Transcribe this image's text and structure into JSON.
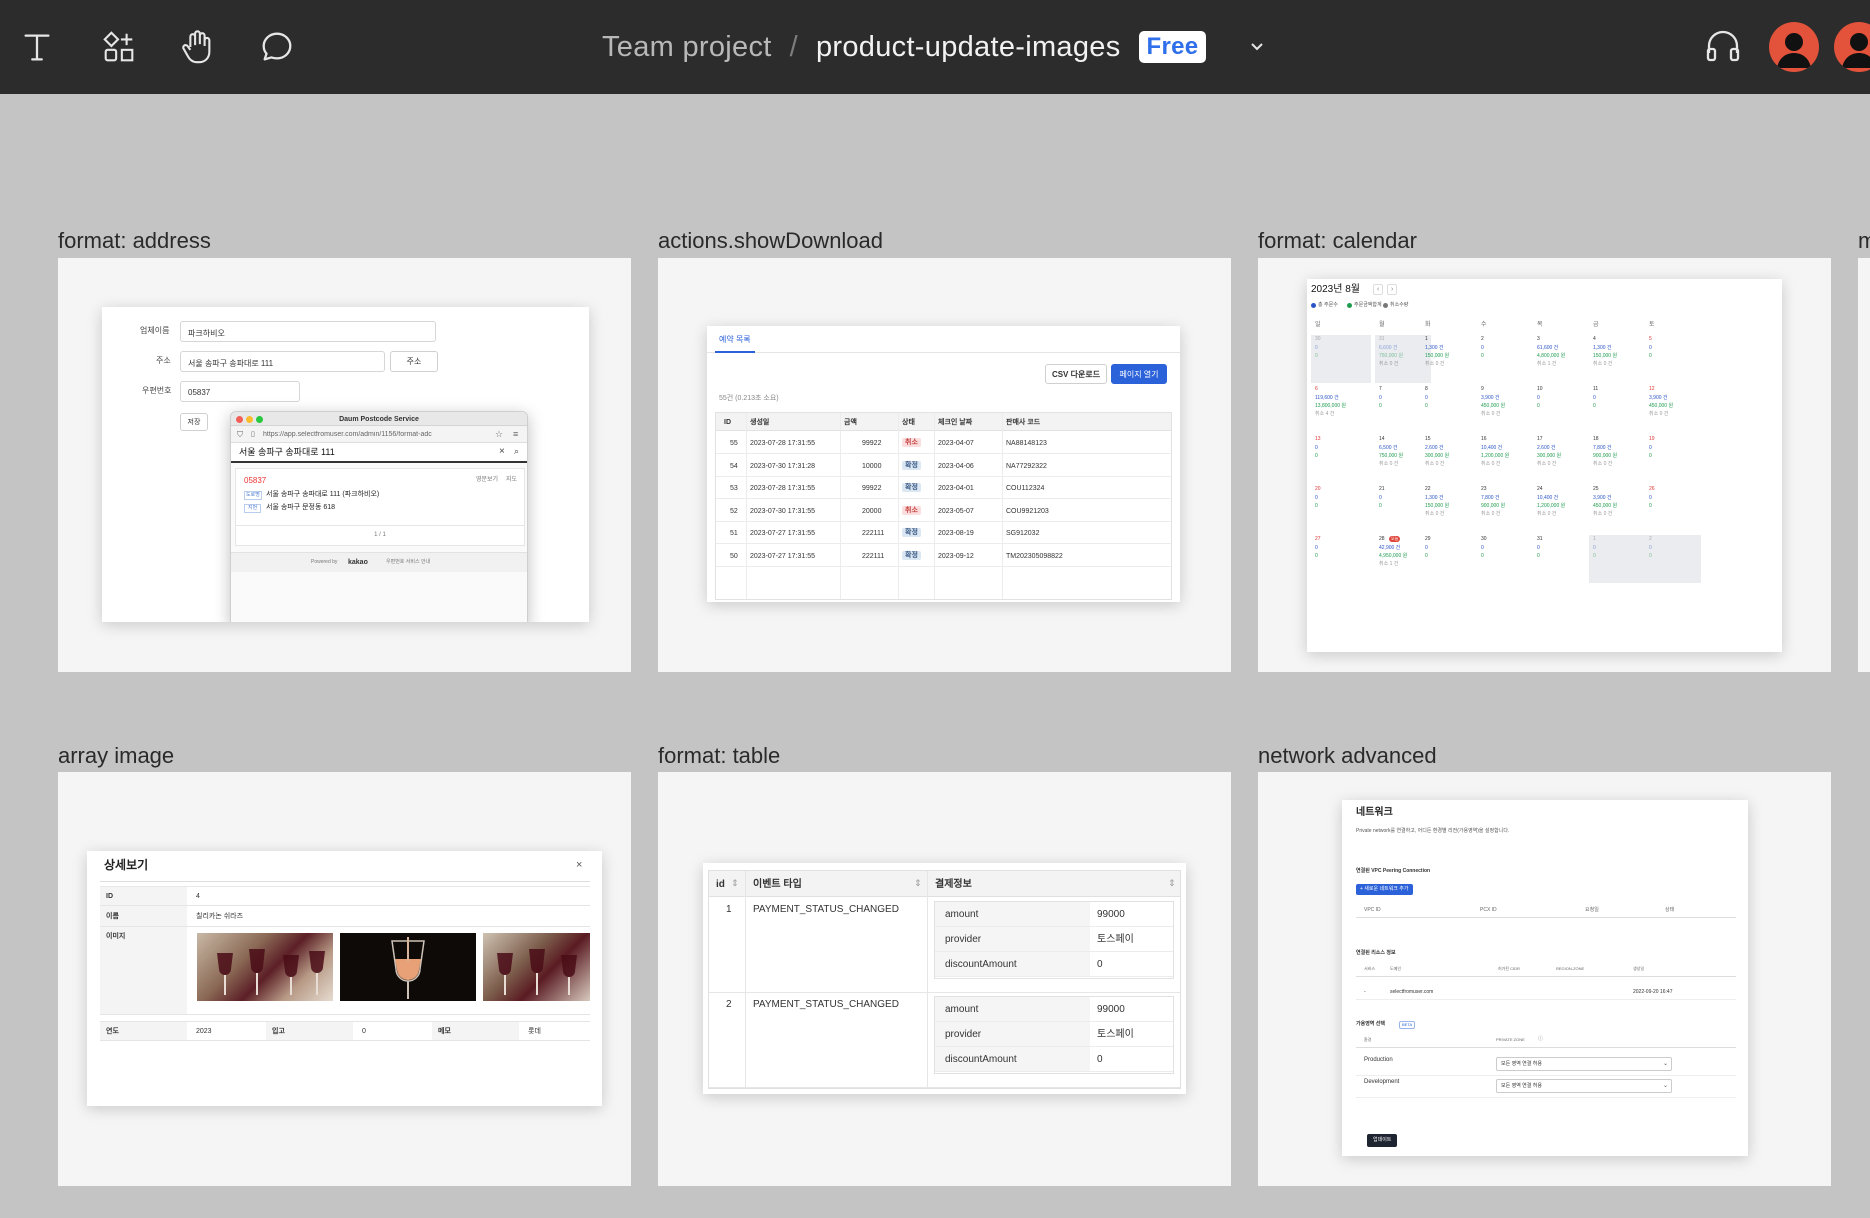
{
  "toolbar": {
    "breadcrumb_team": "Team project",
    "breadcrumb_separator": "/",
    "file_name": "product-update-images",
    "plan_badge": "Free"
  },
  "frames": {
    "address": {
      "title": "format: address",
      "labels": {
        "company": "업체이름",
        "address": "주소",
        "zip": "우편번호"
      },
      "values": {
        "company": "파크하비오",
        "address": "서울 송파구 송파대로 111",
        "zip": "05837"
      },
      "address_button": "주소",
      "save_button": "저장",
      "popup": {
        "title": "Daum Postcode Service",
        "url": "https://app.selectfromuser.com/admin/1156/format-adc",
        "search_value": "서울 송파구 송파대로 111",
        "result_zip": "05837",
        "result_actions": [
          "영문보기",
          "지도"
        ],
        "road_tag": "도로명",
        "road_address": "서울 송파구 송파대로 111 (파크하비오)",
        "jibun_tag": "지번",
        "jibun_address": "서울 송파구 문정동 618",
        "pagination": "1 / 1",
        "powered_by": "Powered by",
        "brand": "kakao",
        "service_info": "우편번호 서비스 안내"
      }
    },
    "download": {
      "title": "actions.showDownload",
      "tab": "예약 목록",
      "csv_button": "CSV 다운로드",
      "open_button": "페이지 열기",
      "summary": "55건 (0.213초 소요)",
      "columns": [
        "ID",
        "생성일",
        "금액",
        "상태",
        "체크인 날짜",
        "판매사 코드"
      ],
      "rows": [
        {
          "id": "55",
          "created": "2023-07-28 17:31:55",
          "amount": "99922",
          "status": "취소",
          "checkin": "2023-04-07",
          "code": "NA88148123"
        },
        {
          "id": "54",
          "created": "2023-07-30 17:31:28",
          "amount": "10000",
          "status": "확정",
          "checkin": "2023-04-06",
          "code": "NA77292322"
        },
        {
          "id": "53",
          "created": "2023-07-28 17:31:55",
          "amount": "99922",
          "status": "확정",
          "checkin": "2023-04-01",
          "code": "COU112324"
        },
        {
          "id": "52",
          "created": "2023-07-30 17:31:55",
          "amount": "20000",
          "status": "취소",
          "checkin": "2023-05-07",
          "code": "COU9921203"
        },
        {
          "id": "51",
          "created": "2023-07-27 17:31:55",
          "amount": "222111",
          "status": "확정",
          "checkin": "2023-08-19",
          "code": "SG912032"
        },
        {
          "id": "50",
          "created": "2023-07-27 17:31:55",
          "amount": "222111",
          "status": "확정",
          "checkin": "2023-09-12",
          "code": "TM202305098822"
        }
      ]
    },
    "calendar": {
      "title": "format: calendar",
      "month": "2023년 8월",
      "nav_prev": "‹",
      "nav_next": "›",
      "legend": [
        "총 주문수",
        "주문금액합계",
        "취소수량"
      ],
      "legend_colors": [
        "#2b55c6",
        "#1f9b4f",
        "#777777"
      ],
      "weekdays": [
        "일",
        "월",
        "화",
        "수",
        "목",
        "금",
        "토"
      ],
      "weeks": [
        [
          {
            "d": "30",
            "a": "0",
            "b": "0",
            "c": "",
            "out": true
          },
          {
            "d": "31",
            "a": "6,600 건",
            "b": "750,000 원",
            "c": "취소 0 건",
            "out": true
          },
          {
            "d": "1",
            "a": "1,300 건",
            "b": "150,000 원",
            "c": "취소 0 건"
          },
          {
            "d": "2",
            "a": "0",
            "b": "0",
            "c": ""
          },
          {
            "d": "3",
            "a": "61,600 건",
            "b": "4,800,000 원",
            "c": "취소 1 건"
          },
          {
            "d": "4",
            "a": "1,300 건",
            "b": "150,000 원",
            "c": "취소 0 건"
          },
          {
            "d": "5",
            "a": "0",
            "b": "0",
            "c": ""
          }
        ],
        [
          {
            "d": "6",
            "a": "119,600 건",
            "b": "13,800,000 원",
            "c": "취소 4 건"
          },
          {
            "d": "7",
            "a": "0",
            "b": "0",
            "c": ""
          },
          {
            "d": "8",
            "a": "0",
            "b": "0",
            "c": ""
          },
          {
            "d": "9",
            "a": "3,900 건",
            "b": "450,000 원",
            "c": "취소 0 건"
          },
          {
            "d": "10",
            "a": "0",
            "b": "0",
            "c": ""
          },
          {
            "d": "11",
            "a": "0",
            "b": "0",
            "c": ""
          },
          {
            "d": "12",
            "a": "3,900 건",
            "b": "450,000 원",
            "c": "취소 0 건"
          }
        ],
        [
          {
            "d": "13",
            "a": "0",
            "b": "0",
            "c": ""
          },
          {
            "d": "14",
            "a": "6,500 건",
            "b": "750,000 원",
            "c": "취소 0 건"
          },
          {
            "d": "15",
            "a": "2,600 건",
            "b": "300,000 원",
            "c": "취소 0 건"
          },
          {
            "d": "16",
            "a": "10,400 건",
            "b": "1,200,000 원",
            "c": "취소 0 건"
          },
          {
            "d": "17",
            "a": "2,600 건",
            "b": "300,000 원",
            "c": "취소 0 건"
          },
          {
            "d": "18",
            "a": "7,800 건",
            "b": "900,000 원",
            "c": "취소 0 건"
          },
          {
            "d": "19",
            "a": "0",
            "b": "0",
            "c": ""
          }
        ],
        [
          {
            "d": "20",
            "a": "0",
            "b": "0",
            "c": ""
          },
          {
            "d": "21",
            "a": "0",
            "b": "0",
            "c": ""
          },
          {
            "d": "22",
            "a": "1,300 건",
            "b": "150,000 원",
            "c": "취소 0 건"
          },
          {
            "d": "23",
            "a": "7,800 건",
            "b": "900,000 원",
            "c": "취소 0 건"
          },
          {
            "d": "24",
            "a": "10,400 건",
            "b": "1,200,000 원",
            "c": "취소 0 건"
          },
          {
            "d": "25",
            "a": "3,900 건",
            "b": "450,000 원",
            "c": "취소 0 건"
          },
          {
            "d": "26",
            "a": "0",
            "b": "0",
            "c": ""
          }
        ],
        [
          {
            "d": "27",
            "a": "0",
            "b": "0",
            "c": ""
          },
          {
            "d": "28",
            "a": "42,900 건",
            "b": "4,950,000 원",
            "c": "취소 1 건",
            "today": "오늘"
          },
          {
            "d": "29",
            "a": "0",
            "b": "0",
            "c": ""
          },
          {
            "d": "30",
            "a": "0",
            "b": "0",
            "c": ""
          },
          {
            "d": "31",
            "a": "0",
            "b": "0",
            "c": ""
          },
          {
            "d": "1",
            "a": "0",
            "b": "0",
            "c": "",
            "out": true
          },
          {
            "d": "2",
            "a": "0",
            "b": "0",
            "c": "",
            "out": true
          }
        ]
      ]
    },
    "array_image": {
      "title": "array image",
      "heading": "상세보기",
      "close": "×",
      "labels": {
        "id": "ID",
        "name": "이름",
        "images": "이미지",
        "year": "연도",
        "stock": "입고",
        "memo": "메모"
      },
      "values": {
        "id": "4",
        "name": "칠리카논 쉬라즈",
        "year": "2023",
        "stock": "0",
        "memo": "롯데"
      }
    },
    "table": {
      "title": "format: table",
      "columns": [
        "id",
        "이벤트 타입",
        "결제정보"
      ],
      "rows": [
        {
          "id": "1",
          "type": "PAYMENT_STATUS_CHANGED",
          "info": [
            [
              "amount",
              "99000"
            ],
            [
              "provider",
              "토스페이"
            ],
            [
              "discountAmount",
              "0"
            ]
          ]
        },
        {
          "id": "2",
          "type": "PAYMENT_STATUS_CHANGED",
          "info": [
            [
              "amount",
              "99000"
            ],
            [
              "provider",
              "토스페이"
            ],
            [
              "discountAmount",
              "0"
            ]
          ]
        }
      ]
    },
    "network": {
      "title": "network advanced",
      "heading": "네트워크",
      "description": "Private network를 연결하고, 어디든 환경별 리전(가용영역)을 설정합니다.",
      "vpc_title": "연결된 VPC Peering Connection",
      "add_button": "+ 새로운 네트워크 추가",
      "vpc_columns": [
        "VPC ID",
        "PCX ID",
        "요청일",
        "상태"
      ],
      "resource_title": "연결된 리소스 정보",
      "resource_columns": [
        "서비스",
        "도메인",
        "허가된 CIDR",
        "REGION-ZONE",
        "생성일"
      ],
      "resource_row": {
        "service": "-",
        "domain": "selectfromuser.com",
        "created": "2022-09-20 16:47"
      },
      "zone_title": "가용영역 선택",
      "zone_badge": "BETA",
      "zone_columns": [
        "환경",
        "PRIVATE ZONE"
      ],
      "zone_rows": [
        {
          "env": "Production",
          "select": "모든 영역 연결 허용"
        },
        {
          "env": "Development",
          "select": "모든 영역 연결 허용"
        }
      ],
      "update_button": "업데이트"
    },
    "partial_title": "m"
  }
}
